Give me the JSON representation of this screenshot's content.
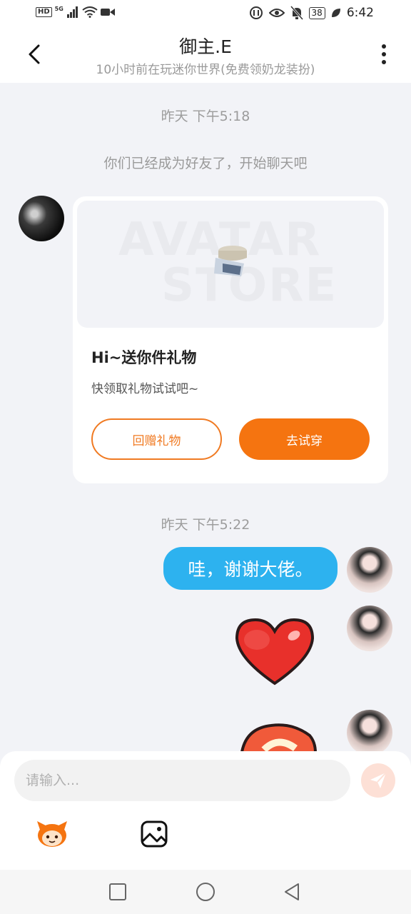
{
  "status_bar": {
    "network_hd": "HD",
    "network_5g": "5G",
    "battery": "38",
    "time": "6:42"
  },
  "header": {
    "title": "御主.E",
    "subtitle": "10小时前在玩迷你世界(免费领奶龙装扮)"
  },
  "messages": {
    "timestamp_1": "昨天 下午5:18",
    "system_notice": "你们已经成为好友了，开始聊天吧",
    "gift_card": {
      "banner_watermark_1": "AVATAR",
      "banner_watermark_2": "STORE",
      "title": "Hi~送你件礼物",
      "description": "快领取礼物试试吧~",
      "return_gift_label": "回赠礼物",
      "try_on_label": "去试穿"
    },
    "timestamp_2": "昨天 下午5:22",
    "reply_text": "哇，谢谢大佬。"
  },
  "input": {
    "placeholder": "请输入..."
  },
  "colors": {
    "accent_orange": "#f57410",
    "bubble_blue": "#2db2ef",
    "background": "#f2f3f7"
  }
}
